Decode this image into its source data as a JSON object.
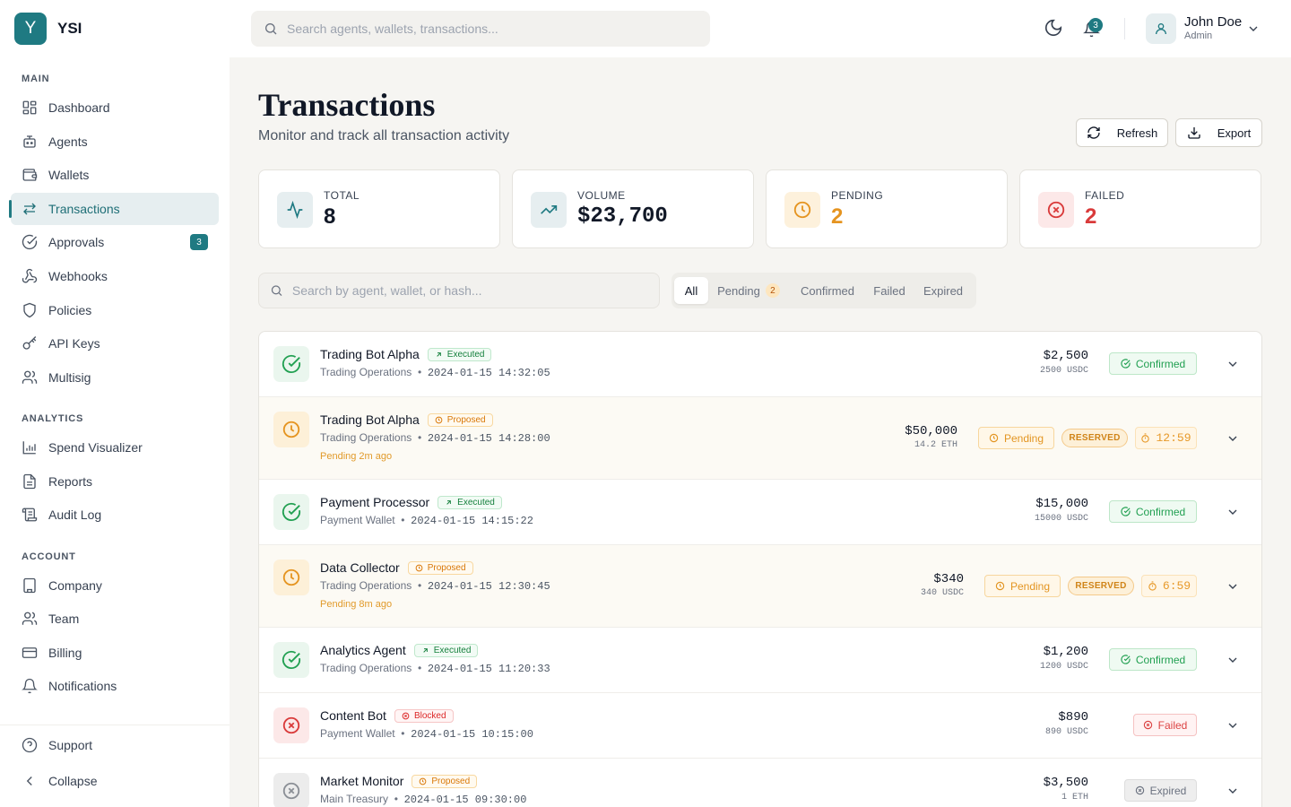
{
  "brand": {
    "logo_letter": "Y",
    "name": "YSI"
  },
  "sidebar": {
    "sections": [
      {
        "label": "MAIN"
      },
      {
        "label": "ANALYTICS"
      },
      {
        "label": "ACCOUNT"
      }
    ],
    "items": [
      {
        "label": "Dashboard",
        "icon": "dashboard-icon"
      },
      {
        "label": "Agents",
        "icon": "bot-icon"
      },
      {
        "label": "Wallets",
        "icon": "wallet-icon"
      },
      {
        "label": "Transactions",
        "icon": "transfer-icon",
        "active": true
      },
      {
        "label": "Approvals",
        "icon": "check-circle-icon",
        "badge": "3"
      },
      {
        "label": "Webhooks",
        "icon": "webhook-icon"
      },
      {
        "label": "Policies",
        "icon": "shield-icon"
      },
      {
        "label": "API Keys",
        "icon": "key-icon"
      },
      {
        "label": "Multisig",
        "icon": "users-icon"
      },
      {
        "label": "Spend Visualizer",
        "icon": "bar-chart-icon"
      },
      {
        "label": "Reports",
        "icon": "file-icon"
      },
      {
        "label": "Audit Log",
        "icon": "scroll-icon"
      },
      {
        "label": "Company",
        "icon": "building-icon"
      },
      {
        "label": "Team",
        "icon": "users-icon"
      },
      {
        "label": "Billing",
        "icon": "credit-card-icon"
      },
      {
        "label": "Notifications",
        "icon": "bell-icon"
      }
    ],
    "footer": {
      "support": "Support",
      "collapse": "Collapse"
    }
  },
  "topbar": {
    "search_placeholder": "Search agents, wallets, transactions...",
    "notification_count": "3",
    "user": {
      "name": "John Doe",
      "role": "Admin"
    }
  },
  "page": {
    "title": "Transactions",
    "subtitle": "Monitor and track all transaction activity",
    "refresh_label": "Refresh",
    "export_label": "Export"
  },
  "stats": [
    {
      "label": "TOTAL",
      "value": "8",
      "color": "#111827",
      "icon": "activity-icon"
    },
    {
      "label": "VOLUME",
      "value": "$23,700",
      "color": "#111827",
      "icon": "trending-up-icon"
    },
    {
      "label": "PENDING",
      "value": "2",
      "color": "#e59420",
      "icon": "clock-icon"
    },
    {
      "label": "FAILED",
      "value": "2",
      "color": "#d93a3a",
      "icon": "x-circle-icon"
    }
  ],
  "filters": {
    "search_placeholder": "Search by agent, wallet, or hash...",
    "tabs": [
      {
        "label": "All",
        "active": true
      },
      {
        "label": "Pending",
        "count": "2"
      },
      {
        "label": "Confirmed"
      },
      {
        "label": "Failed"
      },
      {
        "label": "Expired"
      }
    ]
  },
  "transactions": [
    {
      "agent": "Trading Bot Alpha",
      "tag": "Executed",
      "wallet": "Trading Operations",
      "time": "2024-01-15 14:32:05",
      "amount": "$2,500",
      "token": "2500 USDC",
      "status": "Confirmed"
    },
    {
      "agent": "Trading Bot Alpha",
      "tag": "Proposed",
      "wallet": "Trading Operations",
      "time": "2024-01-15 14:28:00",
      "note": "Pending 2m ago",
      "amount": "$50,000",
      "token": "14.2 ETH",
      "status": "Pending",
      "reserved": "RESERVED",
      "timer": "12:59"
    },
    {
      "agent": "Payment Processor",
      "tag": "Executed",
      "wallet": "Payment Wallet",
      "time": "2024-01-15 14:15:22",
      "amount": "$15,000",
      "token": "15000 USDC",
      "status": "Confirmed"
    },
    {
      "agent": "Data Collector",
      "tag": "Proposed",
      "wallet": "Trading Operations",
      "time": "2024-01-15 12:30:45",
      "note": "Pending 8m ago",
      "amount": "$340",
      "token": "340 USDC",
      "status": "Pending",
      "reserved": "RESERVED",
      "timer": "6:59"
    },
    {
      "agent": "Analytics Agent",
      "tag": "Executed",
      "wallet": "Trading Operations",
      "time": "2024-01-15 11:20:33",
      "amount": "$1,200",
      "token": "1200 USDC",
      "status": "Confirmed"
    },
    {
      "agent": "Content Bot",
      "tag": "Blocked",
      "wallet": "Payment Wallet",
      "time": "2024-01-15 10:15:00",
      "amount": "$890",
      "token": "890 USDC",
      "status": "Failed"
    },
    {
      "agent": "Market Monitor",
      "tag": "Proposed",
      "wallet": "Main Treasury",
      "time": "2024-01-15 09:30:00",
      "amount": "$3,500",
      "token": "1 ETH",
      "status": "Expired"
    }
  ],
  "colors": {
    "accent": "#1f7a82",
    "success": "#22a052",
    "warning": "#e59420",
    "danger": "#d93a3a",
    "muted": "#6b7280"
  }
}
